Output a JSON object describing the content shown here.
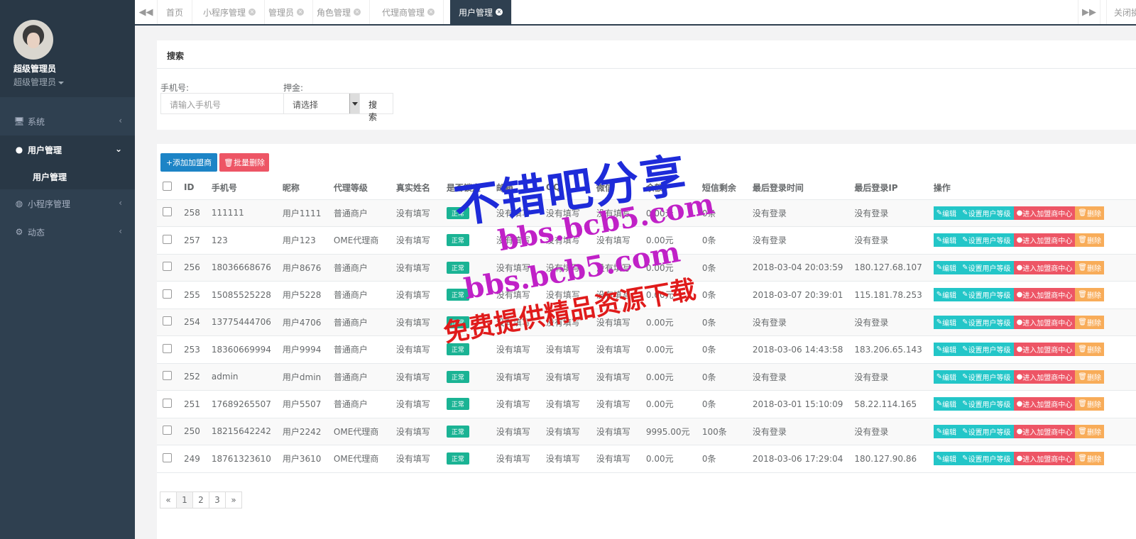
{
  "profile": {
    "name": "超级管理员",
    "role": "超级管理员"
  },
  "sidebar": {
    "items": [
      {
        "label": "系统",
        "icon": "monitor-icon"
      },
      {
        "label": "用户管理",
        "icon": "user-icon",
        "active": true,
        "sub": [
          "用户管理"
        ]
      },
      {
        "label": "小程序管理",
        "icon": "wechat-icon"
      },
      {
        "label": "动态",
        "icon": "gears-icon"
      }
    ]
  },
  "tabs": {
    "items": [
      "首页",
      "小程序管理",
      "管理员",
      "角色管理",
      "代理商管理",
      "用户管理"
    ],
    "active": "用户管理",
    "close_ops": "关闭操作"
  },
  "search": {
    "title": "搜索",
    "phone_label": "手机号:",
    "phone_placeholder": "请输入手机号",
    "deposit_label": "押金:",
    "deposit_value": "请选择",
    "search_button": "搜索"
  },
  "toolbar": {
    "add_label": "+添加加盟商",
    "batch_delete_label": "批量删除"
  },
  "table": {
    "headers": [
      "ID",
      "手机号",
      "昵称",
      "代理等级",
      "真实姓名",
      "是否锁定",
      "邮箱",
      "QQ",
      "微信",
      "余额",
      "短信剩余",
      "最后登录时间",
      "最后登录IP",
      "操作"
    ],
    "rows": [
      [
        "258",
        "111111",
        "用户1111",
        "普通商户",
        "没有填写",
        "正常",
        "没有填写",
        "没有填写",
        "没有填写",
        "0.00元",
        "0条",
        "没有登录",
        "没有登录"
      ],
      [
        "257",
        "123",
        "用户123",
        "OME代理商",
        "没有填写",
        "正常",
        "没有填写",
        "没有填写",
        "没有填写",
        "0.00元",
        "0条",
        "没有登录",
        "没有登录"
      ],
      [
        "256",
        "18036668676",
        "用户8676",
        "普通商户",
        "没有填写",
        "正常",
        "没有填写",
        "没有填写",
        "没有填写",
        "0.00元",
        "0条",
        "2018-03-04 20:03:59",
        "180.127.68.107"
      ],
      [
        "255",
        "15085525228",
        "用户5228",
        "普通商户",
        "没有填写",
        "正常",
        "没有填写",
        "没有填写",
        "没有填写",
        "0.00元",
        "0条",
        "2018-03-07 20:39:01",
        "115.181.78.253"
      ],
      [
        "254",
        "13775444706",
        "用户4706",
        "普通商户",
        "没有填写",
        "正常",
        "没有填写",
        "没有填写",
        "没有填写",
        "0.00元",
        "0条",
        "没有登录",
        "没有登录"
      ],
      [
        "253",
        "18360669994",
        "用户9994",
        "普通商户",
        "没有填写",
        "正常",
        "没有填写",
        "没有填写",
        "没有填写",
        "0.00元",
        "0条",
        "2018-03-06 14:43:58",
        "183.206.65.143"
      ],
      [
        "252",
        "admin",
        "用户dmin",
        "普通商户",
        "没有填写",
        "正常",
        "没有填写",
        "没有填写",
        "没有填写",
        "0.00元",
        "0条",
        "没有登录",
        "没有登录"
      ],
      [
        "251",
        "17689265507",
        "用户5507",
        "普通商户",
        "没有填写",
        "正常",
        "没有填写",
        "没有填写",
        "没有填写",
        "0.00元",
        "0条",
        "2018-03-01 15:10:09",
        "58.22.114.165"
      ],
      [
        "250",
        "18215642242",
        "用户2242",
        "OME代理商",
        "没有填写",
        "正常",
        "没有填写",
        "没有填写",
        "没有填写",
        "9995.00元",
        "100条",
        "没有登录",
        "没有登录"
      ],
      [
        "249",
        "18761323610",
        "用户3610",
        "OME代理商",
        "没有填写",
        "正常",
        "没有填写",
        "没有填写",
        "没有填写",
        "0.00元",
        "0条",
        "2018-03-06 17:29:04",
        "180.127.90.86"
      ]
    ],
    "actions": {
      "edit": "编辑",
      "level": "设置用户等级",
      "enter": "进入加盟商中心",
      "delete": "删除"
    }
  },
  "pagination": {
    "items": [
      "«",
      "1",
      "2",
      "3",
      "»"
    ],
    "current": "1"
  },
  "watermark": {
    "line1": "不错吧分享",
    "line2": "bbs.bcb5.com",
    "line3": "bbs.bcb5.com",
    "line4": "免费提供精品资源下载"
  }
}
